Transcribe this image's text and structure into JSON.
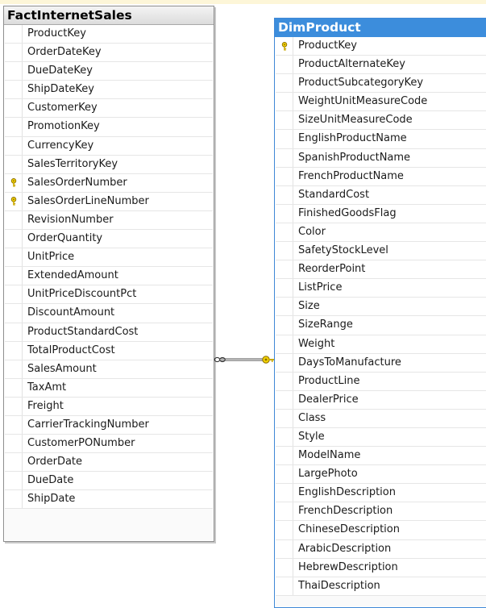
{
  "tables": [
    {
      "id": "fact",
      "name": "FactInternetSales",
      "columns": [
        {
          "name": "ProductKey",
          "key": false
        },
        {
          "name": "OrderDateKey",
          "key": false
        },
        {
          "name": "DueDateKey",
          "key": false
        },
        {
          "name": "ShipDateKey",
          "key": false
        },
        {
          "name": "CustomerKey",
          "key": false
        },
        {
          "name": "PromotionKey",
          "key": false
        },
        {
          "name": "CurrencyKey",
          "key": false
        },
        {
          "name": "SalesTerritoryKey",
          "key": false
        },
        {
          "name": "SalesOrderNumber",
          "key": true
        },
        {
          "name": "SalesOrderLineNumber",
          "key": true
        },
        {
          "name": "RevisionNumber",
          "key": false
        },
        {
          "name": "OrderQuantity",
          "key": false
        },
        {
          "name": "UnitPrice",
          "key": false
        },
        {
          "name": "ExtendedAmount",
          "key": false
        },
        {
          "name": "UnitPriceDiscountPct",
          "key": false
        },
        {
          "name": "DiscountAmount",
          "key": false
        },
        {
          "name": "ProductStandardCost",
          "key": false
        },
        {
          "name": "TotalProductCost",
          "key": false
        },
        {
          "name": "SalesAmount",
          "key": false
        },
        {
          "name": "TaxAmt",
          "key": false
        },
        {
          "name": "Freight",
          "key": false
        },
        {
          "name": "CarrierTrackingNumber",
          "key": false
        },
        {
          "name": "CustomerPONumber",
          "key": false
        },
        {
          "name": "OrderDate",
          "key": false
        },
        {
          "name": "DueDate",
          "key": false
        },
        {
          "name": "ShipDate",
          "key": false
        }
      ]
    },
    {
      "id": "dim",
      "name": "DimProduct",
      "columns": [
        {
          "name": "ProductKey",
          "key": true
        },
        {
          "name": "ProductAlternateKey",
          "key": false
        },
        {
          "name": "ProductSubcategoryKey",
          "key": false
        },
        {
          "name": "WeightUnitMeasureCode",
          "key": false
        },
        {
          "name": "SizeUnitMeasureCode",
          "key": false
        },
        {
          "name": "EnglishProductName",
          "key": false
        },
        {
          "name": "SpanishProductName",
          "key": false
        },
        {
          "name": "FrenchProductName",
          "key": false
        },
        {
          "name": "StandardCost",
          "key": false
        },
        {
          "name": "FinishedGoodsFlag",
          "key": false
        },
        {
          "name": "Color",
          "key": false
        },
        {
          "name": "SafetyStockLevel",
          "key": false
        },
        {
          "name": "ReorderPoint",
          "key": false
        },
        {
          "name": "ListPrice",
          "key": false
        },
        {
          "name": "Size",
          "key": false
        },
        {
          "name": "SizeRange",
          "key": false
        },
        {
          "name": "Weight",
          "key": false
        },
        {
          "name": "DaysToManufacture",
          "key": false
        },
        {
          "name": "ProductLine",
          "key": false
        },
        {
          "name": "DealerPrice",
          "key": false
        },
        {
          "name": "Class",
          "key": false
        },
        {
          "name": "Style",
          "key": false
        },
        {
          "name": "ModelName",
          "key": false
        },
        {
          "name": "LargePhoto",
          "key": false
        },
        {
          "name": "EnglishDescription",
          "key": false
        },
        {
          "name": "FrenchDescription",
          "key": false
        },
        {
          "name": "ChineseDescription",
          "key": false
        },
        {
          "name": "ArabicDescription",
          "key": false
        },
        {
          "name": "HebrewDescription",
          "key": false
        },
        {
          "name": "ThaiDescription",
          "key": false
        }
      ]
    }
  ],
  "relationship": {
    "from": "FactInternetSales",
    "to": "DimProduct",
    "many_end_icon": "infinity-icon",
    "one_end_icon": "key-icon"
  },
  "colors": {
    "active_title": "#3c8ddc",
    "key": "#f2d100",
    "border": "#8e8e8e"
  }
}
